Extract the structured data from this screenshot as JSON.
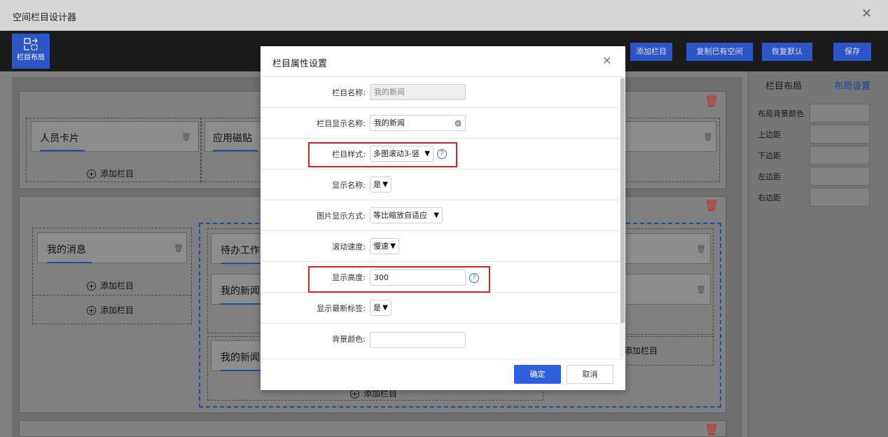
{
  "window": {
    "title": "空间栏目设计器"
  },
  "toolbar": {
    "layout_btn": "栏目布局",
    "add_column": "添加栏目",
    "copy_space": "复制已有空间",
    "restore_default": "恢复默认",
    "save": "保存"
  },
  "canvas": {
    "row1": {
      "cards": [
        "人员卡片",
        "应用磁贴"
      ],
      "add": "添加栏目"
    },
    "row2": {
      "left_card": "我的消息",
      "left_add": "添加栏目",
      "left_add2": "添加栏目",
      "mid_cards": [
        "待办工作",
        "我的新闻",
        "我的新闻"
      ],
      "mid_add": "添加栏目",
      "right_add": "添加栏目"
    }
  },
  "right_panel": {
    "tabs": [
      "栏目布局",
      "布局设置"
    ],
    "fields": [
      "布局背景颜色",
      "上边距",
      "下边距",
      "左边距",
      "右边距"
    ]
  },
  "modal": {
    "title": "栏目属性设置",
    "rows": [
      {
        "label": "栏目名称:",
        "value": "我的新闻"
      },
      {
        "label": "栏目显示名称:",
        "value": "我的新闻"
      },
      {
        "label": "栏目样式:",
        "value": "多图滚动3-竖"
      },
      {
        "label": "显示名称:",
        "value": "是"
      },
      {
        "label": "图片显示方式:",
        "value": "等比缩放自适应"
      },
      {
        "label": "滚动速度:",
        "value": "慢速"
      },
      {
        "label": "显示高度:",
        "value": "300"
      },
      {
        "label": "显示最新标签:",
        "value": "是"
      },
      {
        "label": "背景颜色:",
        "value": ""
      }
    ],
    "ok": "确定",
    "cancel": "取消"
  },
  "colors": {
    "accent": "#2d55c8",
    "primary_btn": "#2d5fe0",
    "delete": "#c03030",
    "highlight": "#e02020"
  }
}
